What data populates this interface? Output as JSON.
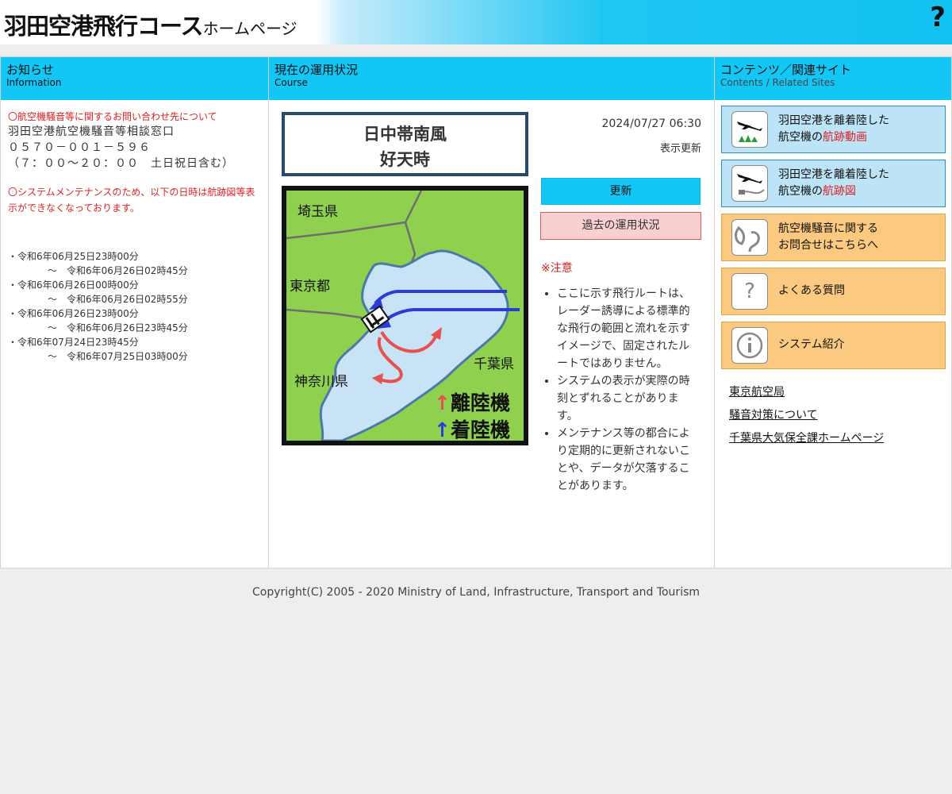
{
  "header": {
    "title_main": "羽田空港飛行コース",
    "title_sub": "ホームページ",
    "help_icon": "?"
  },
  "info": {
    "heading": "お知らせ",
    "heading_en": "Information",
    "contact_title": "〇航空機騒音等に関するお問い合わせ先について",
    "contact_name": "羽田空港航空機騒音等相談窓口",
    "contact_phone": "０５７０－００１－５９６",
    "contact_hours": "（７：００～２０：００　土日祝日含む）",
    "maint_notice": "〇システムメンテナンスのため、以下の日時は航跡図等表示ができなくなっております。",
    "schedule": [
      {
        "start": "・令和6年06月25日23時00分",
        "end": "～　令和6年06月26日02時45分"
      },
      {
        "start": "・令和6年06月26日00時00分",
        "end": "～　令和6年06月26日02時55分"
      },
      {
        "start": "・令和6年06月26日23時00分",
        "end": "～　令和6年06月26日23時45分"
      },
      {
        "start": "・令和6年07月24日23時45分",
        "end": "～　令和6年07月25日03時00分"
      }
    ]
  },
  "course": {
    "heading": "現在の運用状況",
    "heading_en": "Course",
    "status_line1": "日中帯南風",
    "status_line2": "好天時",
    "timestamp": "2024/07/27 06:30",
    "timestamp_label": "表示更新",
    "update_button": "更新",
    "past_button": "過去の運用状況",
    "notice_title": "※注意",
    "notes": [
      "ここに示す飛行ルートは、レーダー誘導による標準的な飛行の範囲と流れを示すイメージで、固定されたルートではありません。",
      "システムの表示が実際の時刻とずれることがあります。",
      "メンテナンス等の都合により定期的に更新されないことや、データが欠落することがあります。"
    ],
    "map": {
      "label_saitama": "埼玉県",
      "label_tokyo": "東京都",
      "label_chiba": "千葉県",
      "label_kanagawa": "神奈川県",
      "legend_departure": "離陸機",
      "legend_arrival": "着陸機",
      "legend_arrow": "↑",
      "departure_color": "#e85050",
      "arrival_color": "#2b3cd8"
    }
  },
  "contents": {
    "heading": "コンテンツ／関連サイト",
    "heading_en": "Contents / Related Sites",
    "links": [
      {
        "line1": "羽田空港を離着陸した",
        "line2_a": "航空機の",
        "line2_b": "航跡動画",
        "icon": "airplane-video-icon"
      },
      {
        "line1": "羽田空港を離着陸した",
        "line2_a": "航空機の",
        "line2_b": "航跡図",
        "icon": "airplane-track-icon"
      },
      {
        "line1": "航空機騒音に関する",
        "line2": "お問合せはこちらへ",
        "icon": "noise-inquiry-icon"
      },
      {
        "label": "よくある質問",
        "icon": "question-icon"
      },
      {
        "label": "システム紹介",
        "icon": "info-icon"
      }
    ],
    "text_links": [
      "東京航空局",
      "騒音対策について",
      "千葉県大気保全課ホームページ"
    ]
  },
  "footer": {
    "copyright": "Copyright(C) 2005 - 2020 Ministry of Land, Infrastructure, Transport and Tourism"
  }
}
